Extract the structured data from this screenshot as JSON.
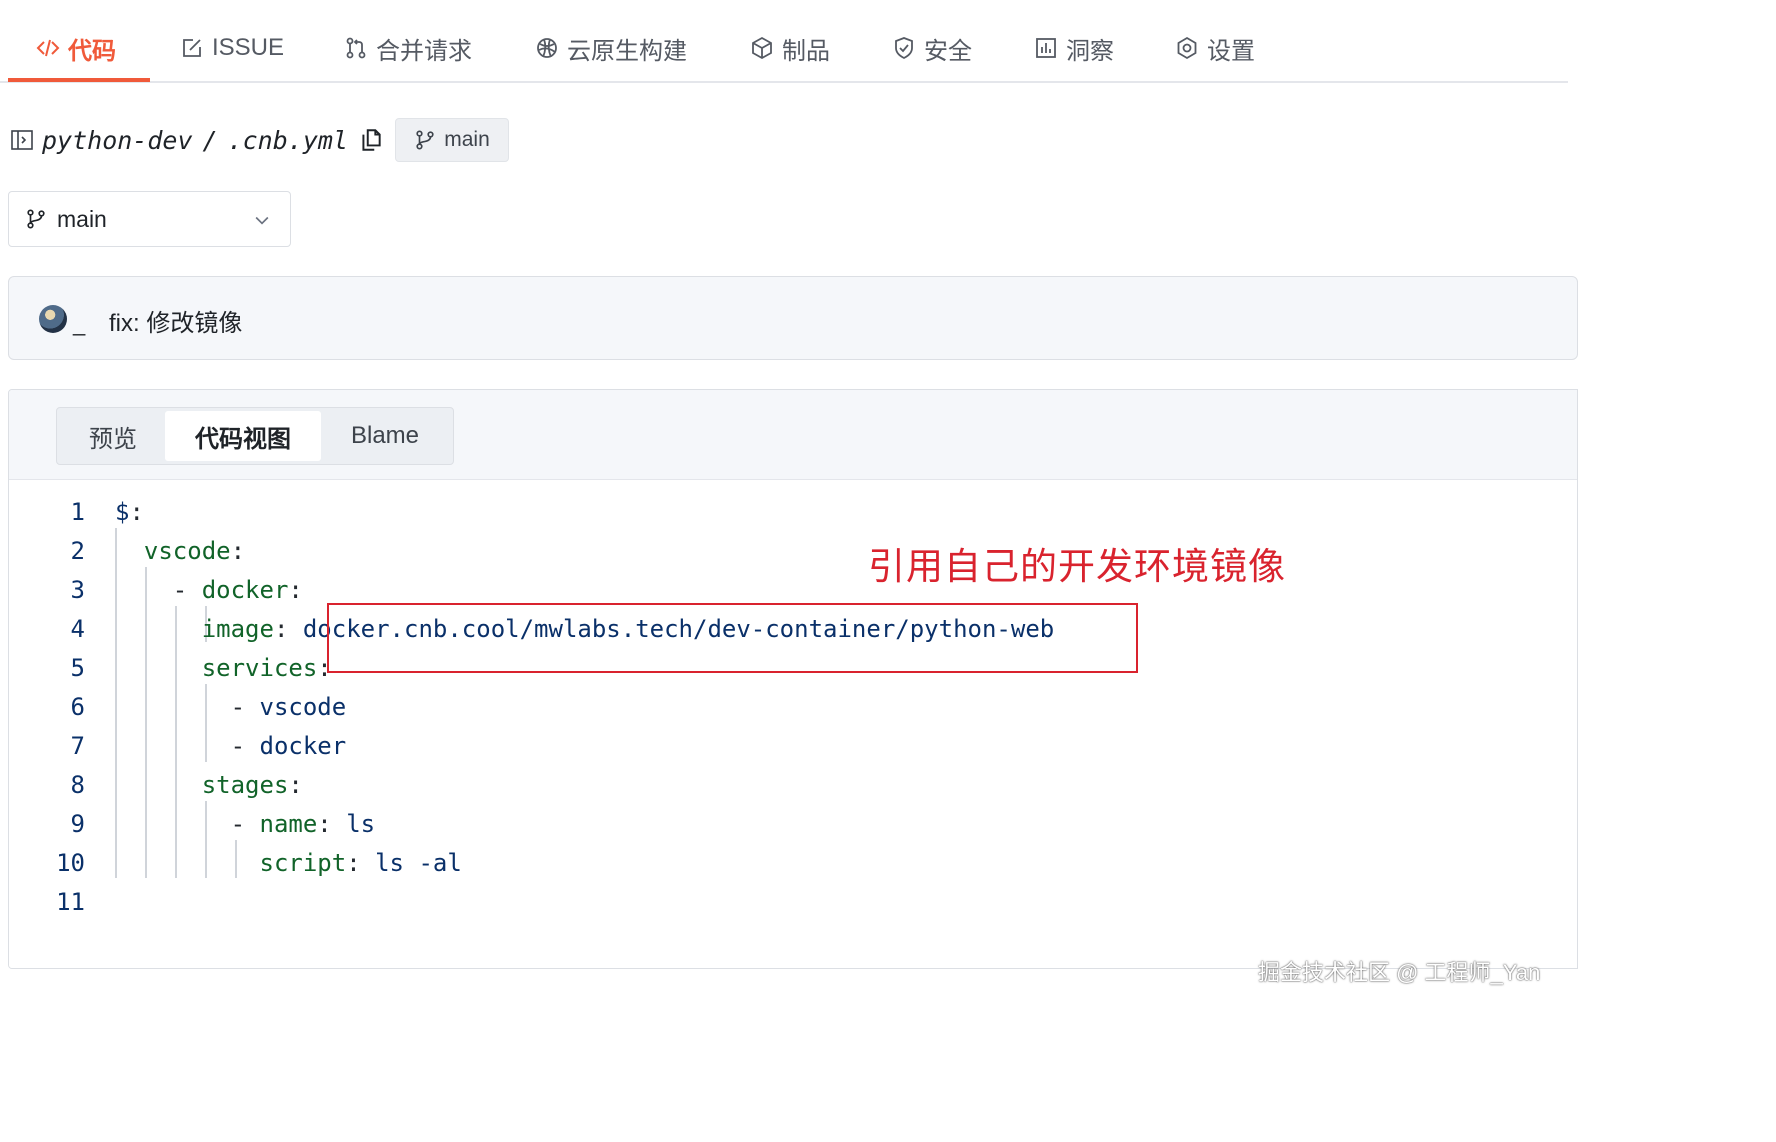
{
  "nav": {
    "tabs": [
      {
        "label": "代码",
        "icon": "code-icon",
        "active": true
      },
      {
        "label": "ISSUE",
        "icon": "issue-icon"
      },
      {
        "label": "合并请求",
        "icon": "pull-request-icon"
      },
      {
        "label": "云原生构建",
        "icon": "build-icon"
      },
      {
        "label": "制品",
        "icon": "package-icon"
      },
      {
        "label": "安全",
        "icon": "shield-icon"
      },
      {
        "label": "洞察",
        "icon": "insights-icon"
      },
      {
        "label": "设置",
        "icon": "gear-icon"
      }
    ]
  },
  "file": {
    "repo": "python-dev",
    "separator": "/",
    "filename": ".cnb.yml",
    "branch_badge": "main"
  },
  "branch_selector": {
    "value": "main"
  },
  "commit": {
    "author": "_",
    "message": "fix: 修改镜像"
  },
  "view_tabs": {
    "preview": "预览",
    "code_view": "代码视图",
    "blame": "Blame",
    "active": "代码视图"
  },
  "code": {
    "line_numbers": [
      "1",
      "2",
      "3",
      "4",
      "5",
      "6",
      "7",
      "8",
      "9",
      "10",
      "11"
    ],
    "lines": [
      [
        {
          "t": "$",
          "c": "s"
        },
        {
          "t": ":",
          "c": "p"
        }
      ],
      [
        {
          "t": "  "
        },
        {
          "t": "vscode",
          "c": "k"
        },
        {
          "t": ":",
          "c": "p"
        }
      ],
      [
        {
          "t": "    - ",
          "c": "p"
        },
        {
          "t": "docker",
          "c": "k"
        },
        {
          "t": ":",
          "c": "p"
        }
      ],
      [
        {
          "t": "      "
        },
        {
          "t": "image",
          "c": "k"
        },
        {
          "t": ": ",
          "c": "p"
        },
        {
          "t": "docker.cnb.cool/mwlabs.tech/dev-container/python-web",
          "c": "s"
        }
      ],
      [
        {
          "t": "      "
        },
        {
          "t": "services",
          "c": "k"
        },
        {
          "t": ":",
          "c": "p"
        }
      ],
      [
        {
          "t": "        - ",
          "c": "p"
        },
        {
          "t": "vscode",
          "c": "s"
        }
      ],
      [
        {
          "t": "        - ",
          "c": "p"
        },
        {
          "t": "docker",
          "c": "s"
        }
      ],
      [
        {
          "t": "      "
        },
        {
          "t": "stages",
          "c": "k"
        },
        {
          "t": ":",
          "c": "p"
        }
      ],
      [
        {
          "t": "        - ",
          "c": "p"
        },
        {
          "t": "name",
          "c": "k"
        },
        {
          "t": ": ",
          "c": "p"
        },
        {
          "t": "ls",
          "c": "s"
        }
      ],
      [
        {
          "t": "          "
        },
        {
          "t": "script",
          "c": "k"
        },
        {
          "t": ": ",
          "c": "p"
        },
        {
          "t": "ls -al",
          "c": "s"
        }
      ],
      []
    ]
  },
  "annotation": "引用自己的开发环境镜像",
  "watermark": "掘金技术社区 @ 工程师_Yan",
  "colors": {
    "accent": "#f05a3a",
    "annotation": "#d9232e",
    "key": "#116329",
    "value": "#0a3069"
  }
}
